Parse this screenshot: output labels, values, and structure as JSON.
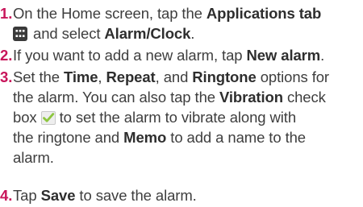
{
  "steps": [
    {
      "number": "1.",
      "lines": [
        [
          "On the Home screen, tap the ",
          "Applications tab"
        ],
        [
          "and select ",
          "Alarm/Clock",
          "."
        ]
      ]
    },
    {
      "number": "2.",
      "lines": [
        [
          "If you want to add a new alarm, tap ",
          "New alarm",
          "."
        ]
      ]
    },
    {
      "number": "3.",
      "lines": [
        [
          "Set the ",
          "Time",
          ", ",
          "Repeat",
          ", and ",
          "Ringtone",
          " options for"
        ],
        [
          "the alarm. You can also tap the ",
          "Vibration",
          " check"
        ],
        [
          "box",
          "to set the alarm to vibrate along with"
        ],
        [
          "the ringtone and ",
          "Memo",
          " to add a name to the"
        ],
        [
          "alarm."
        ]
      ]
    },
    {
      "number": "4.",
      "lines": [
        [
          "Tap ",
          "Save",
          " to save the alarm."
        ]
      ]
    }
  ],
  "icons": {
    "applications": "applications-grid-icon",
    "checkbox": "checkbox-checked-icon"
  },
  "colors": {
    "step_number": "#c8155a",
    "text": "#3e3e3e",
    "icon_dark": "#3a3a3a",
    "check_green": "#8dc63f"
  }
}
